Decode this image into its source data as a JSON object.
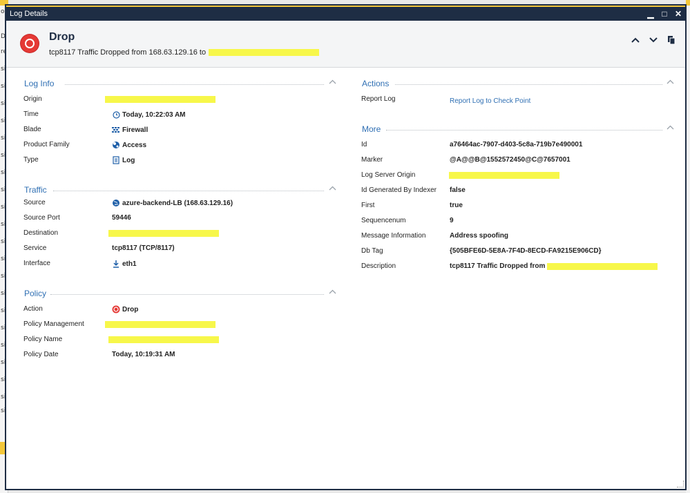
{
  "window": {
    "title": "Log Details",
    "controls": {
      "minimize": "▁",
      "maximize": "□",
      "close": "✕"
    }
  },
  "header": {
    "title": "Drop",
    "subtitle": "tcp8117 Traffic Dropped from 168.63.129.16 to",
    "nav_up": "⌃",
    "nav_down": "⌄"
  },
  "background": {
    "rows": [
      "o",
      "D",
      "re",
      "si",
      "si",
      "si",
      "si",
      "si",
      "si",
      "si",
      "si",
      "si",
      "si",
      "si",
      "si",
      "si",
      "si",
      "si",
      "si",
      "si",
      "si",
      "si",
      "si",
      "si",
      "si",
      "si",
      "si",
      "si"
    ]
  },
  "log_info": {
    "title": "Log Info",
    "rows": [
      {
        "label": "Origin",
        "value": ""
      },
      {
        "label": "Time",
        "value": "Today, 10:22:03 AM",
        "icon": "clock-icon"
      },
      {
        "label": "Blade",
        "value": "Firewall",
        "icon": "firewall-icon"
      },
      {
        "label": "Product Family",
        "value": "Access",
        "icon": "access-icon"
      },
      {
        "label": "Type",
        "value": "Log",
        "icon": "log-icon"
      }
    ]
  },
  "traffic": {
    "title": "Traffic",
    "rows": [
      {
        "label": "Source",
        "value": "azure-backend-LB (168.63.129.16)",
        "icon": "globe-icon"
      },
      {
        "label": "Source Port",
        "value": "59446"
      },
      {
        "label": "Destination",
        "value": ""
      },
      {
        "label": "Service",
        "value": "tcp8117 (TCP/8117)"
      },
      {
        "label": "Interface",
        "value": "eth1",
        "icon": "download-icon"
      }
    ]
  },
  "policy": {
    "title": "Policy",
    "rows": [
      {
        "label": "Action",
        "value": "Drop",
        "icon": "drop-icon"
      },
      {
        "label": "Policy Management",
        "value": ""
      },
      {
        "label": "Policy Name",
        "value": ""
      },
      {
        "label": "Policy Date",
        "value": "Today, 10:19:31 AM"
      }
    ]
  },
  "actions": {
    "title": "Actions",
    "rows": [
      {
        "label": "Report Log",
        "value": "Report Log to Check Point"
      }
    ]
  },
  "more": {
    "title": "More",
    "rows": [
      {
        "label": "Id",
        "value": "a76464ac-7907-d403-5c8a-719b7e490001"
      },
      {
        "label": "Marker",
        "value": "@A@@B@1552572450@C@7657001"
      },
      {
        "label": "Log Server Origin",
        "value": ""
      },
      {
        "label": "Id Generated By Indexer",
        "value": "false"
      },
      {
        "label": "First",
        "value": "true"
      },
      {
        "label": "Sequencenum",
        "value": "9"
      },
      {
        "label": "Message Information",
        "value": "Address spoofing"
      },
      {
        "label": "Db Tag",
        "value": "{505BFE6D-5E8A-7F4D-8ECD-FA9215E906CD}"
      },
      {
        "label": "Description",
        "value": "tcp8117 Traffic Dropped from"
      }
    ]
  },
  "colors": {
    "accent": "#2f6fb3",
    "titlebar": "#1e2d44",
    "redaction": "#f7f74a",
    "drop": "#e53935"
  }
}
